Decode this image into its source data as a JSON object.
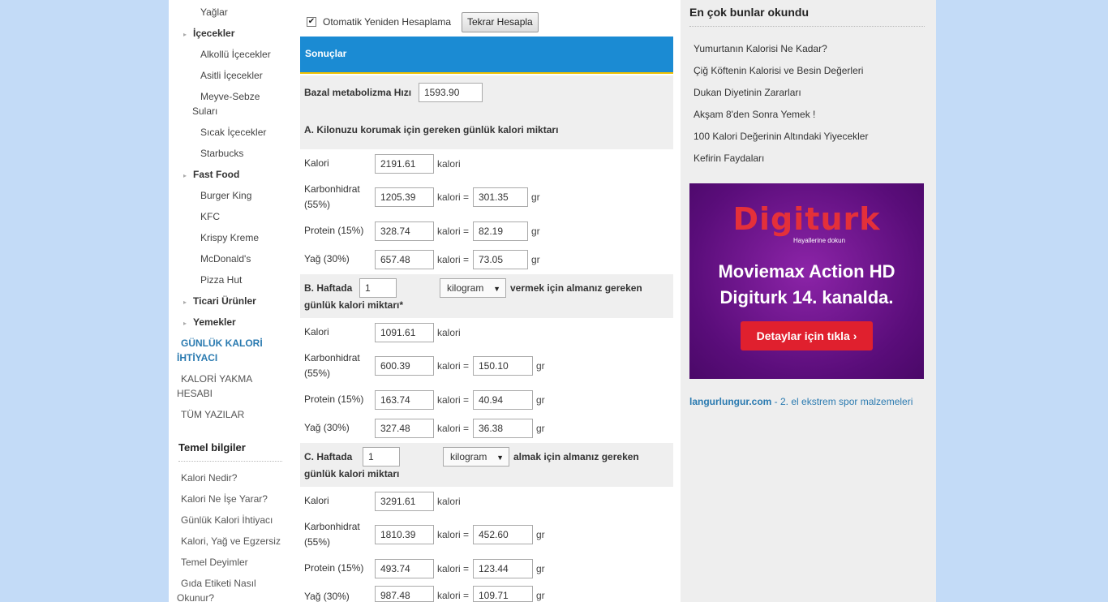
{
  "left_sidebar": {
    "items_top": [
      "Yağlar"
    ],
    "icecekler": "İçecekler",
    "icecek_items": [
      "Alkollü İçecekler",
      "Asitli İçecekler",
      "Meyve-Sebze Suları",
      "Sıcak İçecekler",
      "Starbucks"
    ],
    "fast_food": "Fast Food",
    "fast_food_items": [
      "Burger King",
      "KFC",
      "Krispy Kreme",
      "McDonald's",
      "Pizza Hut"
    ],
    "ticari": "Ticari Ürünler",
    "yemekler": "Yemekler",
    "links": [
      "GÜNLÜK KALORİ İHTİYACI",
      "KALORİ YAKMA HESABI",
      "TÜM YAZILAR"
    ],
    "temel_heading": "Temel bilgiler",
    "temel_items": [
      "Kalori Nedir?",
      "Kalori Ne İşe Yarar?",
      "Günlük Kalori İhtiyacı",
      "Kalori, Yağ ve Egzersiz",
      "Temel Deyimler",
      "Gıda Etiketi Nasıl Okunur?"
    ]
  },
  "main": {
    "auto_recalc_label": "Otomatik Yeniden Hesaplama",
    "recalc_button": "Tekrar Hesapla",
    "results_title": "Sonuçlar",
    "bmr_label": "Bazal metabolizma Hızı",
    "bmr_value": "1593.90",
    "section_a_title": "A. Kilonuzu korumak için gereken günlük kalori miktarı",
    "labels": {
      "kalori": "Kalori",
      "karb": "Karbonhidrat (55%)",
      "protein": "Protein (15%)",
      "yag": "Yağ (30%)",
      "unit_kalori": "kalori",
      "unit_kalori_eq": "kalori =",
      "unit_gr": "gr"
    },
    "a": {
      "kalori": "2191.61",
      "karb": "1205.39",
      "karb_gr": "301.35",
      "protein": "328.74",
      "protein_gr": "82.19",
      "yag": "657.48",
      "yag_gr": "73.05"
    },
    "section_b": {
      "prefix": "B. Haftada",
      "amount": "1",
      "unit": "kilogram",
      "suffix": "vermek için almanız gereken",
      "line2": "günlük kalori miktarı*"
    },
    "b": {
      "kalori": "1091.61",
      "karb": "600.39",
      "karb_gr": "150.10",
      "protein": "163.74",
      "protein_gr": "40.94",
      "yag": "327.48",
      "yag_gr": "36.38"
    },
    "section_c": {
      "prefix": "C. Haftada",
      "amount": "1",
      "unit": "kilogram",
      "suffix": "almak için almanız gereken",
      "line2": "günlük kalori miktarı"
    },
    "c": {
      "kalori": "3291.61",
      "karb": "1810.39",
      "karb_gr": "452.60",
      "protein": "493.74",
      "protein_gr": "123.44",
      "yag": "987.48",
      "yag_gr": "109.71"
    }
  },
  "right_sidebar": {
    "heading": "En çok bunlar okundu",
    "links": [
      "Yumurtanın Kalorisi Ne Kadar?",
      "Çiğ Köftenin Kalorisi ve Besin Değerleri",
      "Dukan Diyetinin Zararları",
      "Akşam 8'den Sonra Yemek !",
      "100 Kalori Değerinin Altındaki Yiyecekler",
      "Kefirin Faydaları"
    ],
    "ad": {
      "logo": "Digiturk",
      "tagline": "Hayallerine dokun",
      "line1": "Moviemax Action HD",
      "line2": "Digiturk 14. kanalda.",
      "cta": "Detaylar için tıkla ›"
    },
    "footer_site": "langurlungur.com",
    "footer_text": " - 2. el ekstrem spor malzemeleri"
  },
  "colors": {
    "page_bg": "#c3dbf7",
    "accent_blue": "#1b8bd3",
    "accent_yellow": "#f0c000",
    "link_blue": "#2a7ab0",
    "ad_purple": "#5a0d7a",
    "ad_red": "#e0202e"
  }
}
